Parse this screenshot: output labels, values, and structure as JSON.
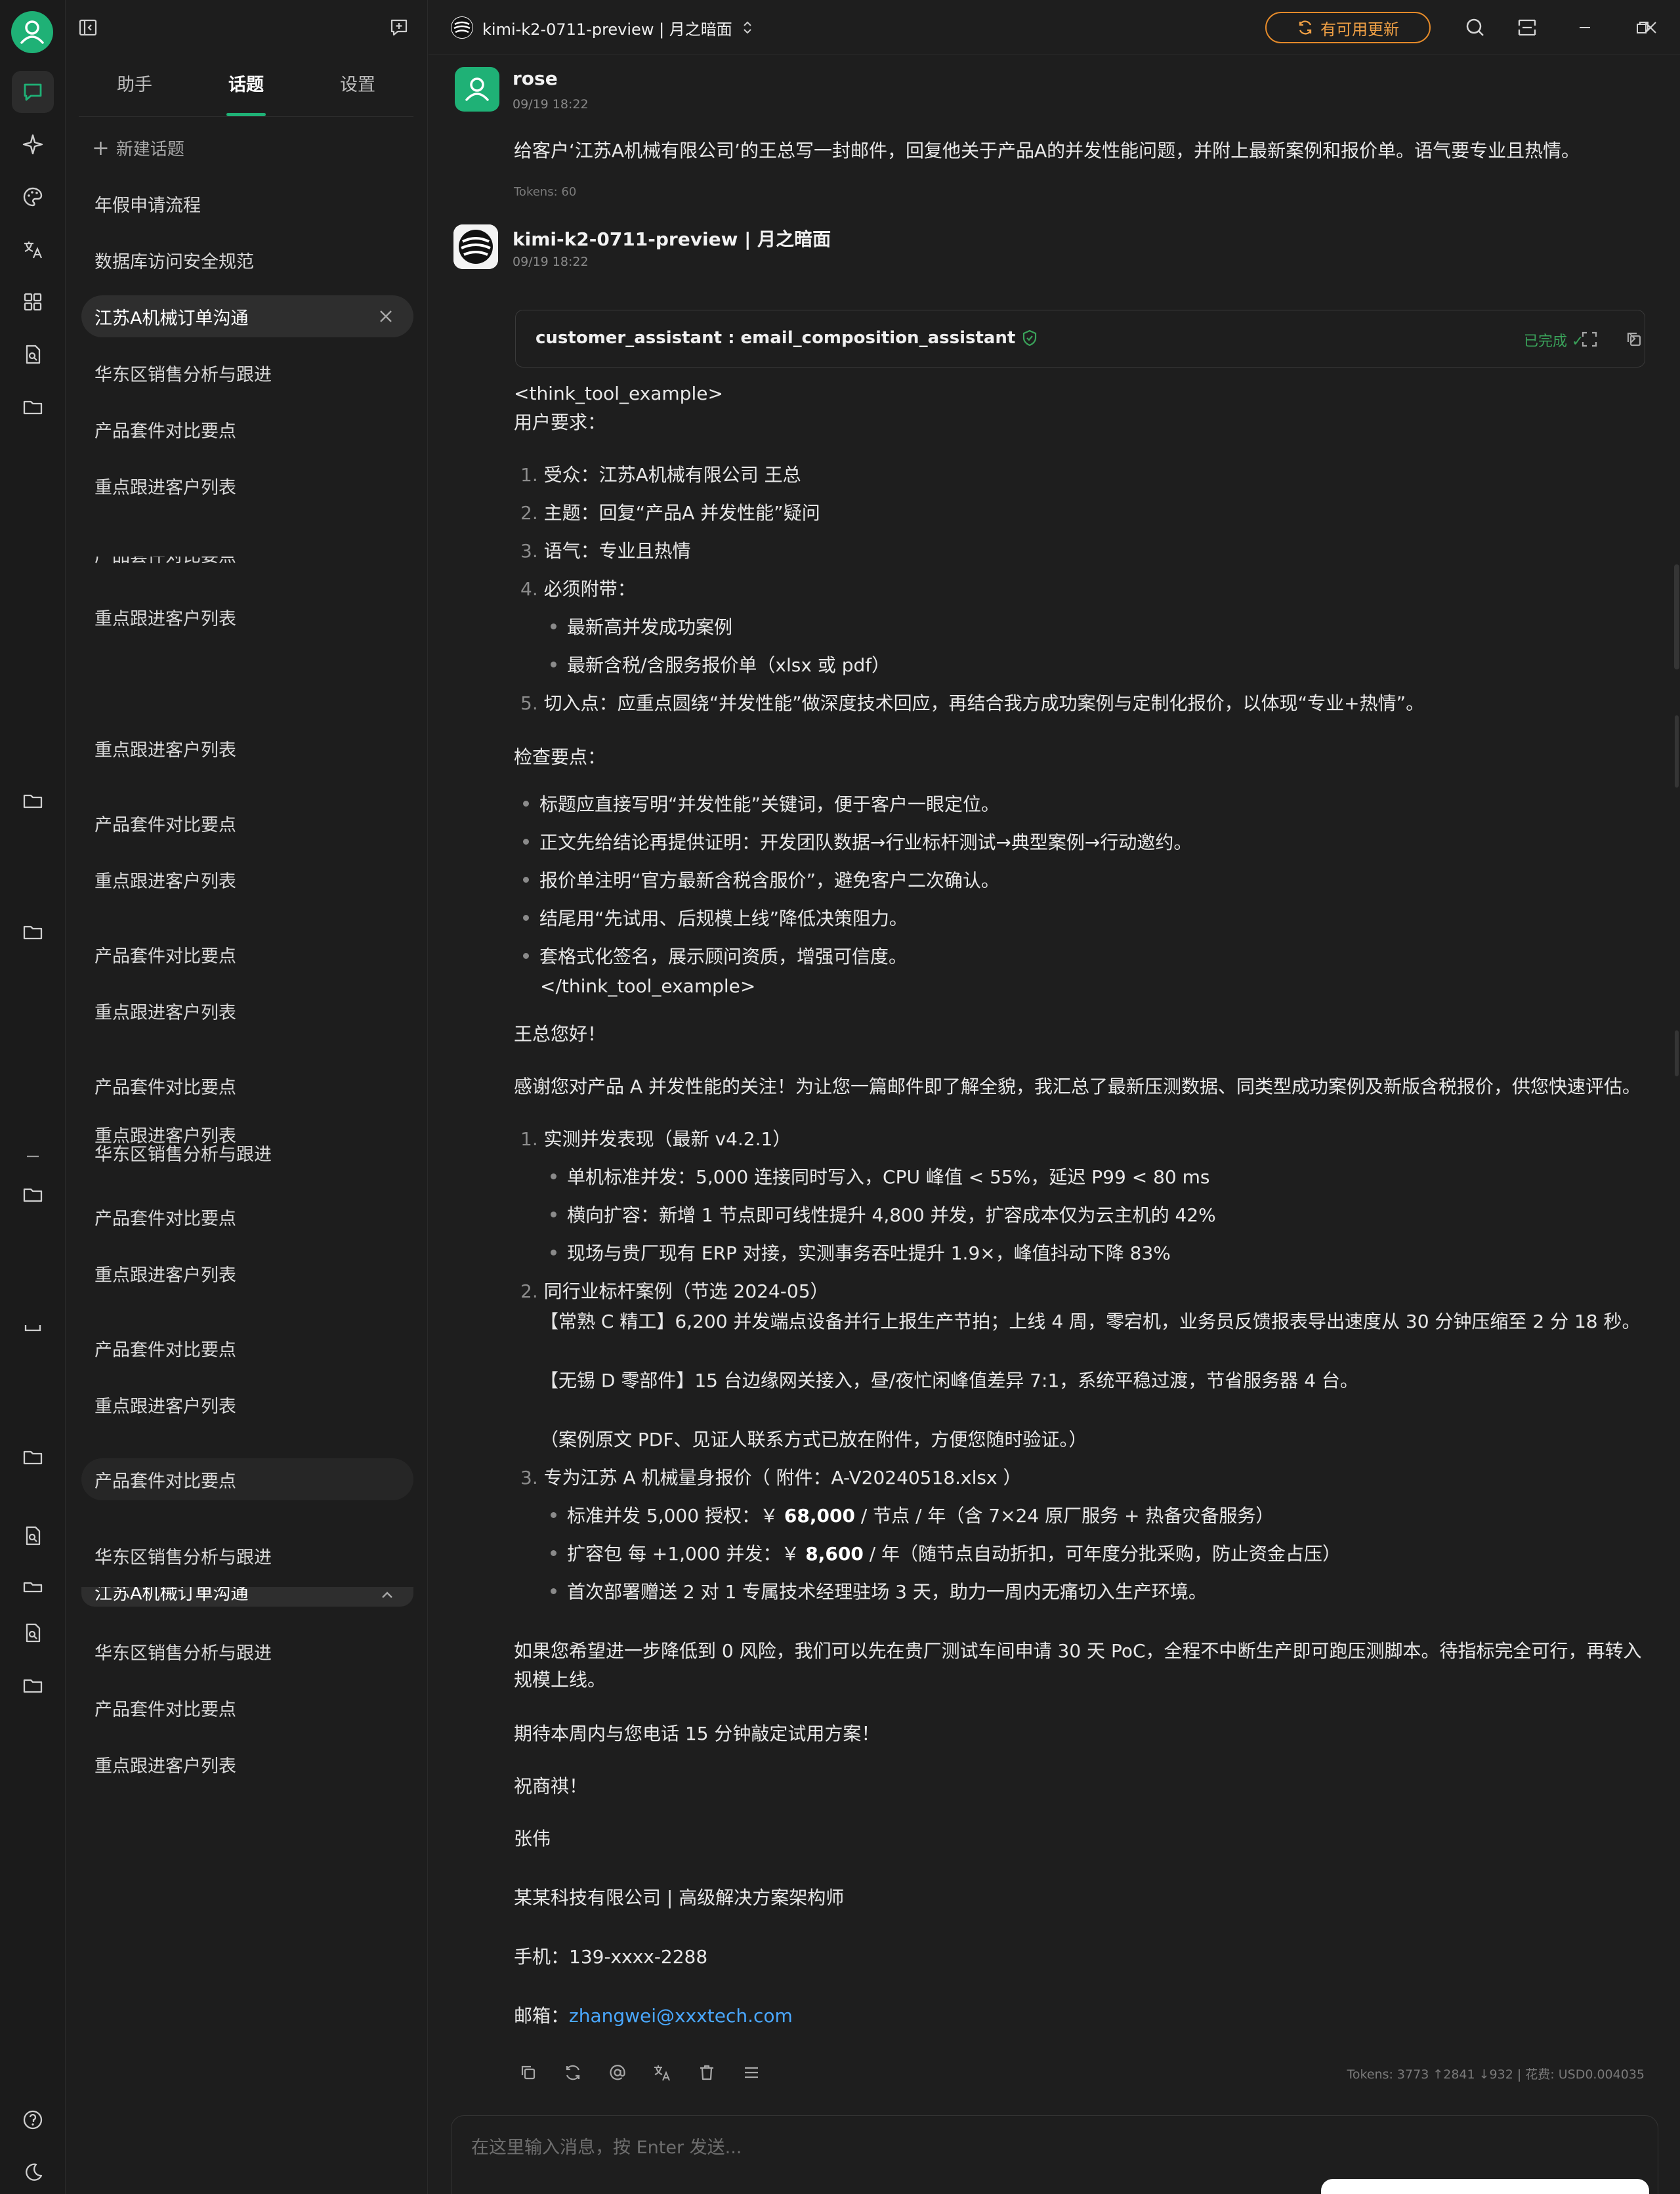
{
  "window": {
    "model_title": "kimi-k2-0711-preview | 月之暗面",
    "update_label": "有可用更新"
  },
  "panel": {
    "tabs": [
      "助手",
      "话题",
      "设置"
    ],
    "active_tab": 1,
    "new_topic": "新建话题",
    "topics": [
      "年假申请流程",
      "数据库访问安全规范",
      "江苏A机械订单沟通",
      "华东区销售分析与跟进",
      "产品套件对比要点",
      "重点跟进客户列表",
      "产品套件对比要点",
      "重点跟进客户列表",
      "重点跟进客户列表",
      "产品套件对比要点",
      "重点跟进客户列表",
      "产品套件对比要点",
      "重点跟进客户列表",
      "产品套件对比要点",
      "重点跟进客户列表",
      "华东区销售分析与跟进",
      "产品套件对比要点",
      "重点跟进客户列表",
      "产品套件对比要点",
      "重点跟进客户列表",
      "产品套件对比要点",
      "华东区销售分析与跟进",
      "江苏A机械订单沟通",
      "华东区销售分析与跟进",
      "产品套件对比要点",
      "重点跟进客户列表"
    ]
  },
  "user_msg": {
    "name": "rose",
    "time": "09/19 18:22",
    "text": "给客户‘江苏A机械有限公司’的王总写一封邮件，回复他关于产品A的并发性能问题，并附上最新案例和报价单。语气要专业且热情。",
    "tokens": "Tokens: 60"
  },
  "bot_msg": {
    "name": "kimi-k2-0711-preview | 月之暗面",
    "time": "09/19 18:22",
    "tool_name": "customer_assistant : email_composition_assistant",
    "tool_status": "已完成",
    "lines": {
      "l0": "<think_tool_example>",
      "l1": "用户要求：",
      "r1n": "1.",
      "r1": "受众：江苏A机械有限公司 王总",
      "r2n": "2.",
      "r2": "主题：回复“产品A 并发性能”疑问",
      "r3n": "3.",
      "r3": "语气：专业且热情",
      "r4n": "4.",
      "r4": "必须附带：",
      "r4a": "最新高并发成功案例",
      "r4b": "最新含税/含服务报价单（xlsx 或 pdf）",
      "r5n": "5.",
      "r5": "切入点：应重点圆绕“并发性能”做深度技术回应，再结合我方成功案例与定制化报价，以体现“专业+热情”。",
      "c0": "检查要点：",
      "c1": "标题应直接写明“并发性能”关键词，便于客户一眼定位。",
      "c2": "正文先给结论再提供证明：开发团队数据→行业标杆测试→典型案例→行动邀约。",
      "c3": "报价单注明“官方最新含税含服价”，避免客户二次确认。",
      "c4": "结尾用“先试用、后规模上线”降低决策阻力。",
      "c5": "套格式化签名，展示顾问资质，增强可信度。",
      "c6": "</think_tool_example>",
      "g0": "王总您好！",
      "g1": "感谢您对产品 A 并发性能的关注！为让您一篇邮件即了解全貌，我汇总了最新压测数据、同类型成功案例及新版含税报价，供您快速评估。",
      "s1n": "1.",
      "s1": "实测并发表现（最新 v4.2.1）",
      "s1a": "单机标准并发：5,000 连接同时写入，CPU 峰值 < 55%，延迟 P99 < 80 ms",
      "s1b": "横向扩容：新增 1 节点即可线性提升 4,800 并发，扩容成本仅为云主机的 42%",
      "s1c": "现场与贵厂现有 ERP 对接，实测事务吞吐提升 1.9×，峰值抖动下降 83%",
      "s2n": "2.",
      "s2": "同行业标杆案例（节选 2024-05）",
      "s2a": "【常熟 C 精工】6,200 并发端点设备并行上报生产节拍；上线 4 周，零宕机，业务员反馈报表导出速度从 30 分钟压缩至 2 分 18 秒。",
      "s2b": "【无锡 D 零部件】15 台边缘网关接入，昼/夜忙闲峰值差异 7:1，系统平稳过渡，节省服务器 4 台。",
      "s2c": "（案例原文 PDF、见证人联系方式已放在附件，方便您随时验证。）",
      "s3n": "3.",
      "s3": "专为江苏 A 机械量身报价（ 附件：A-V20240518.xlsx ）",
      "s3a_pre": "标准并发 5,000 授权：￥ ",
      "s3a_b": "68,000",
      "s3a_post": " / 节点 / 年（含 7×24 原厂服务 + 热备灾备服务）",
      "s3b_pre": "扩容包 每 +1,000 并发：￥ ",
      "s3b_b": "8,600",
      "s3b_post": " / 年（随节点自动折扣，可年度分批采购，防止资金占压）",
      "s3c": "首次部署赠送 2 对 1 专属技术经理驻场 3 天，助力一周内无痛切入生产环境。",
      "p1": "如果您希望进一步降低到 0 风险，我们可以先在贵厂测试车间申请 30 天 PoC，全程不中断生产即可跑压测脚本。待指标完全可行，再转入",
      "p1b": "规模上线。",
      "p2": "期待本周内与您电话 15 分钟敲定试用方案！",
      "p3": "祝商祺！",
      "p4": "张伟",
      "p5": "某某科技有限公司 | 高级解决方案架构师",
      "p6": "手机：139-xxxx-2288",
      "p7": "邮箱：",
      "email": "zhangwei@xxxtech.com"
    },
    "token_stats": "Tokens: 3773 ↑2841 ↓932 | 花费: USD0.004035"
  },
  "input": {
    "placeholder": "在这里输入消息，按 Enter 发送..."
  },
  "colors": {
    "accent": "#1fb176",
    "warning": "#e48a2a",
    "link": "#4aa8ff",
    "success": "#3aa35a"
  }
}
